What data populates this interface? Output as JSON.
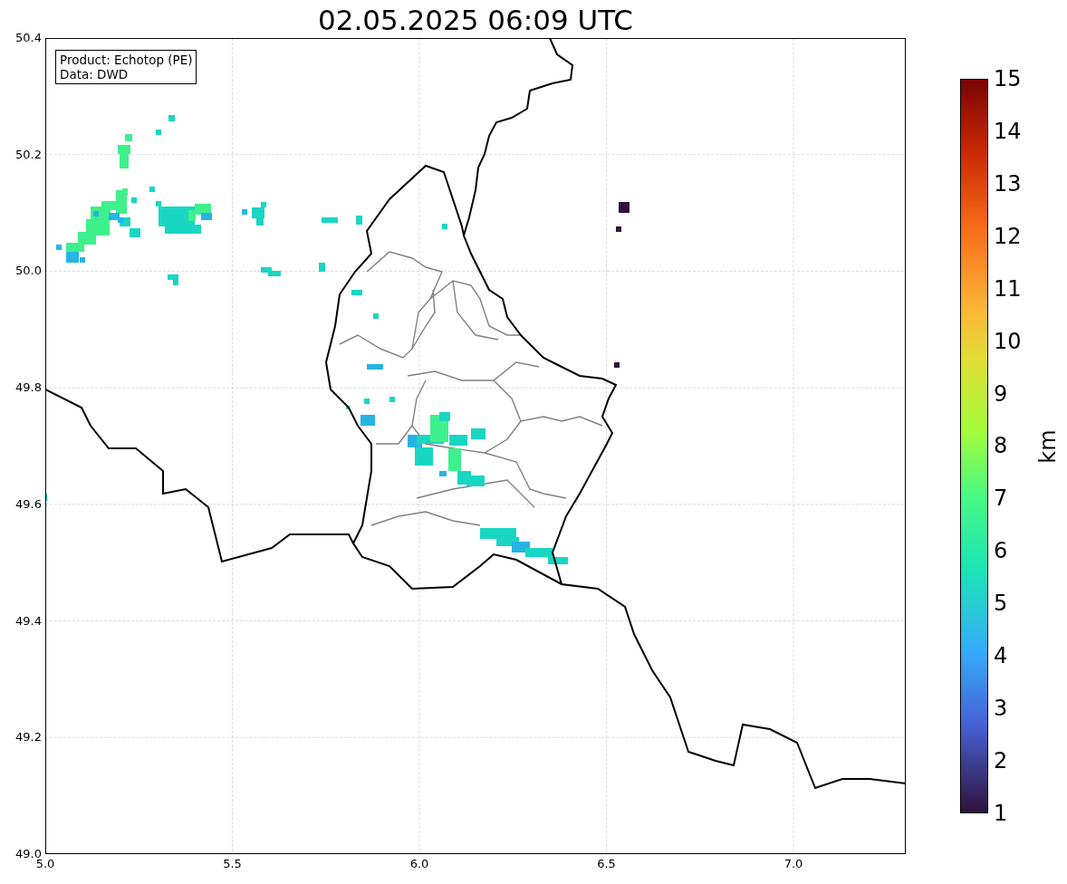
{
  "title": "02.05.2025 06:09 UTC",
  "info_box": {
    "product": "Product: Echotop (PE)",
    "data": "Data: DWD"
  },
  "y_ticks": [
    "50.4",
    "50.2",
    "50.0",
    "49.8",
    "49.6",
    "49.4",
    "49.2",
    "49.0"
  ],
  "x_ticks": [
    "5.0",
    "5.5",
    "6.0",
    "6.5",
    "7.0"
  ],
  "colorbar": {
    "label": "km",
    "ticks": [
      "15",
      "14",
      "13",
      "12",
      "11",
      "10",
      "9",
      "8",
      "7",
      "6",
      "5",
      "4",
      "3",
      "2",
      "1"
    ]
  }
}
